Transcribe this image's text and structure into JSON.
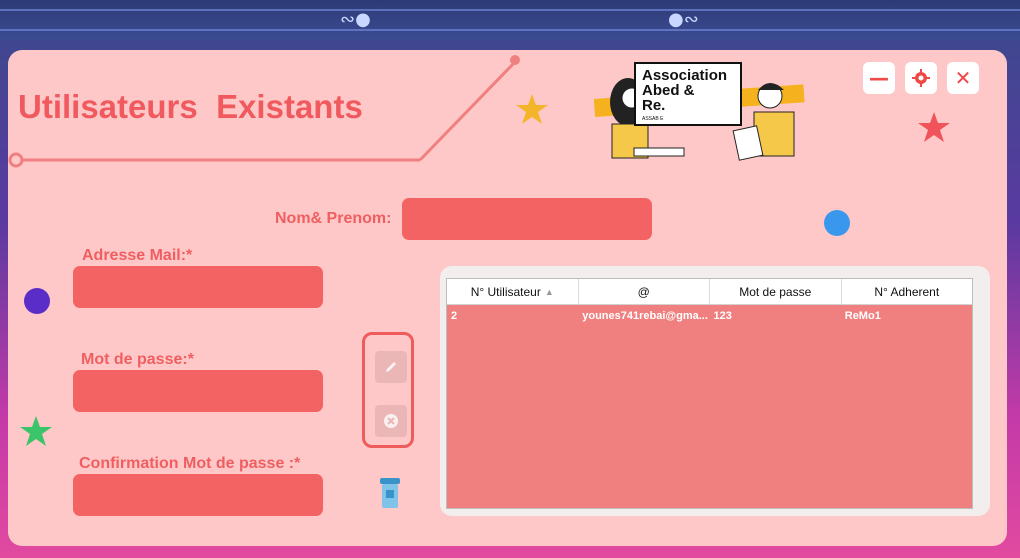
{
  "window": {
    "title": "Utilisateurs  Existants",
    "controls": {
      "minimize": "—",
      "settings": "gear-icon",
      "close": "✕"
    }
  },
  "logo": {
    "line1": "Association",
    "line2": "Abed &",
    "line3": "Re.",
    "small": "ASSAB E"
  },
  "form": {
    "nom_label": "Nom& Prenom:",
    "nom_value": "",
    "email_label": "Adresse Mail:*",
    "email_value": "",
    "password_label": "Mot de passe:*",
    "password_value": "",
    "confirm_label": "Confirmation Mot de passe :*",
    "confirm_value": ""
  },
  "tools": {
    "edit": "pencil-icon",
    "delete": "x-circle-icon",
    "trash": "trash-icon"
  },
  "table": {
    "columns": [
      "N° Utilisateur",
      "@",
      "Mot de passe",
      "N° Adherent"
    ],
    "sort_indicator": "▲",
    "rows": [
      [
        "2",
        "younes741rebai@gma...",
        "123",
        "ReMo1"
      ]
    ]
  },
  "colors": {
    "panel": "#ffc8c8",
    "accent": "#f05a5e",
    "field": "#f46363",
    "table_body": "#f08080"
  }
}
